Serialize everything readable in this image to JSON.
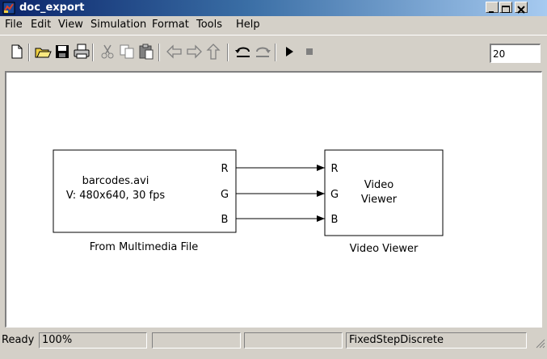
{
  "window": {
    "title": "doc_export"
  },
  "menu": [
    "File",
    "Edit",
    "View",
    "Simulation",
    "Format",
    "Tools",
    "Help"
  ],
  "toolbar": {
    "buttons": [
      "new-icon",
      "open-icon",
      "save-icon",
      "print-icon",
      "cut-icon",
      "copy-icon",
      "paste-icon",
      "back-icon",
      "forward-icon",
      "up-icon",
      "undo-icon",
      "redo-icon",
      "start-simulation-icon",
      "stop-simulation-icon"
    ],
    "stop_time": "20"
  },
  "diagram": {
    "source_block": {
      "line1": "barcodes.avi",
      "line2": "V: 480x640, 30 fps",
      "ports": [
        "R",
        "G",
        "B"
      ],
      "name": "From Multimedia File"
    },
    "viewer_block": {
      "line1": "Video",
      "line2": "Viewer",
      "ports": [
        "R",
        "G",
        "B"
      ],
      "name": "Video Viewer"
    }
  },
  "status": {
    "state": "Ready",
    "zoom": "100%",
    "solver": "FixedStepDiscrete"
  },
  "colors": {
    "titlebar_start": "#0a246a",
    "titlebar_end": "#a6caf0",
    "chrome": "#d4d0c8"
  }
}
